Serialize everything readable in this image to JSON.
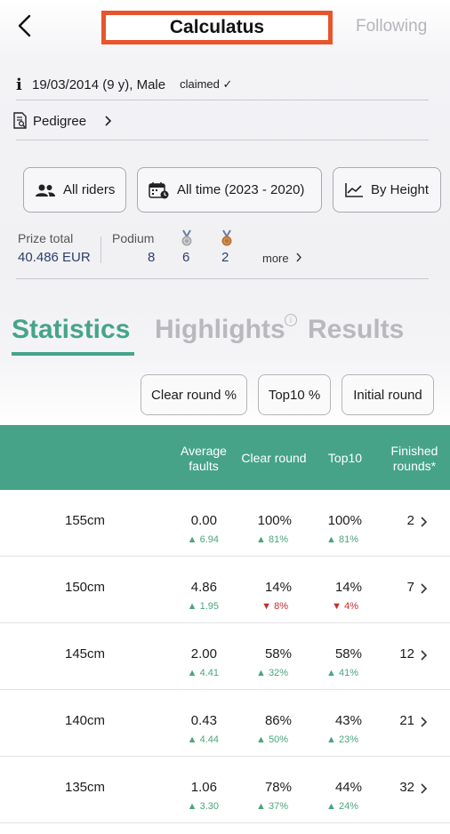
{
  "header": {
    "title": "Calculatus",
    "follow_label": "Following"
  },
  "info": {
    "details": "19/03/2014 (9 y), Male",
    "claimed": "claimed ✓"
  },
  "pedigree": {
    "label": "Pedigree"
  },
  "filters": {
    "riders": "All riders",
    "time": "All time (2023 - 2020)",
    "height": "By Height"
  },
  "summary": {
    "prize_label": "Prize total",
    "prize_value": "40.486 EUR",
    "podium_label": "Podium",
    "podium_values": [
      "8",
      "6",
      "2"
    ],
    "more_label": "more",
    "medal_colors": [
      "#a8a9ad",
      "#b87333"
    ]
  },
  "tabs": [
    "Statistics",
    "Highlights",
    "Results"
  ],
  "chips": [
    "Clear round %",
    "Top10 %",
    "Initial round"
  ],
  "table": {
    "headers": {
      "avg": [
        "Average",
        "faults"
      ],
      "clear": "Clear round",
      "top10": "Top10",
      "finished": [
        "Finished",
        "rounds*"
      ]
    },
    "rows": [
      {
        "height": "155cm",
        "avg": "0.00",
        "avg_sub": "▲ 6.94",
        "clear": "100%",
        "clear_sub": "▲ 81%",
        "top10": "100%",
        "top10_sub": "▲ 81%",
        "rounds": "2"
      },
      {
        "height": "150cm",
        "avg": "4.86",
        "avg_sub": "▲ 1.95",
        "clear": "14%",
        "clear_sub": "▼ 8%",
        "top10": "14%",
        "top10_sub": "▼ 4%",
        "rounds": "7"
      },
      {
        "height": "145cm",
        "avg": "2.00",
        "avg_sub": "▲ 4.41",
        "clear": "58%",
        "clear_sub": "▲ 32%",
        "top10": "58%",
        "top10_sub": "▲ 41%",
        "rounds": "12"
      },
      {
        "height": "140cm",
        "avg": "0.43",
        "avg_sub": "▲ 4.44",
        "clear": "86%",
        "clear_sub": "▲ 50%",
        "top10": "43%",
        "top10_sub": "▲ 23%",
        "rounds": "21"
      },
      {
        "height": "135cm",
        "avg": "1.06",
        "avg_sub": "▲ 3.30",
        "clear": "78%",
        "clear_sub": "▲ 37%",
        "top10": "44%",
        "top10_sub": "▲ 24%",
        "rounds": "32"
      }
    ]
  },
  "colors": {
    "accent": "#46a387",
    "highlight_box": "#e8542c",
    "up": "#4aa57c",
    "down": "#c62b2b"
  }
}
